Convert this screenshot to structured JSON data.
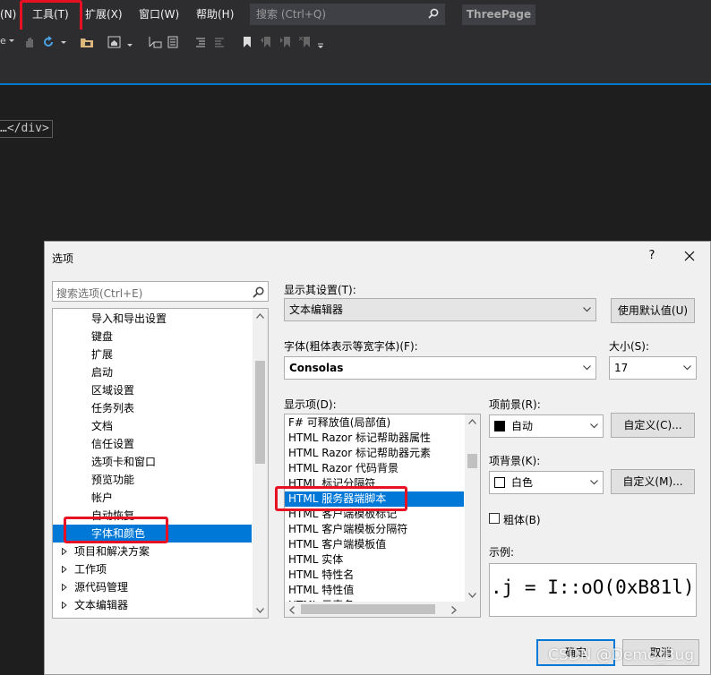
{
  "menubar": {
    "items": [
      "(N)",
      "工具(T)",
      "扩展(X)",
      "窗口(W)",
      "帮助(H)"
    ],
    "search_placeholder": "搜索 (Ctrl+Q)",
    "project_title": "ThreePage"
  },
  "editor": {
    "snippet": "…</div>"
  },
  "dialog": {
    "title": "选项",
    "help": "?",
    "close": "✕",
    "tree_search_placeholder": "搜索选项(Ctrl+E)",
    "tree_items": [
      {
        "label": "导入和导出设置",
        "level": 1
      },
      {
        "label": "键盘",
        "level": 1
      },
      {
        "label": "扩展",
        "level": 1
      },
      {
        "label": "启动",
        "level": 1
      },
      {
        "label": "区域设置",
        "level": 1
      },
      {
        "label": "任务列表",
        "level": 1
      },
      {
        "label": "文档",
        "level": 1
      },
      {
        "label": "信任设置",
        "level": 1
      },
      {
        "label": "选项卡和窗口",
        "level": 1
      },
      {
        "label": "预览功能",
        "level": 1
      },
      {
        "label": "帐户",
        "level": 1
      },
      {
        "label": "自动恢复",
        "level": 1
      },
      {
        "label": "字体和颜色",
        "level": 1,
        "selected": true
      },
      {
        "label": "项目和解决方案",
        "level": 0
      },
      {
        "label": "工作项",
        "level": 0
      },
      {
        "label": "源代码管理",
        "level": 0
      },
      {
        "label": "文本编辑器",
        "level": 0
      }
    ],
    "show_settings_for_label": "显示其设置(T):",
    "show_settings_for_value": "文本编辑器",
    "use_defaults_button": "使用默认值(U)",
    "font_label": "字体(粗体表示等宽字体)(F):",
    "font_value": "Consolas",
    "size_label": "大小(S):",
    "size_value": "17",
    "display_items_label": "显示项(D):",
    "display_items": [
      "F# 可释放值(局部值)",
      "HTML Razor 标记帮助器属性",
      "HTML Razor 标记帮助器元素",
      "HTML Razor 代码背景",
      "HTML 标记分隔符",
      "HTML 服务器端脚本",
      "HTML 客户端模板标记",
      "HTML 客户端模板分隔符",
      "HTML 客户端模板值",
      "HTML 实体",
      "HTML 特性名",
      "HTML 特性值",
      "HTML 元素名"
    ],
    "selected_display_item": 5,
    "foreground_label": "项前景(R):",
    "foreground_value": "自动",
    "foreground_swatch": "#000000",
    "background_label": "项背景(K):",
    "background_value": "白色",
    "background_swatch": "#ffffff",
    "custom_fg_button": "自定义(C)...",
    "custom_bg_button": "自定义(M)...",
    "bold_label": "粗体(B)",
    "sample_label": "示例:",
    "sample_text": ".j = I::oO(0xB81l);",
    "ok_button": "确定",
    "cancel_button": "取消"
  },
  "watermark": "CSDN @Demo_Bug",
  "colors": {
    "ide_bg": "#1e1e1e",
    "chrome": "#2d2d30",
    "accent": "#007acc",
    "selection": "#0078d7",
    "highlight_box": "#e81123"
  }
}
